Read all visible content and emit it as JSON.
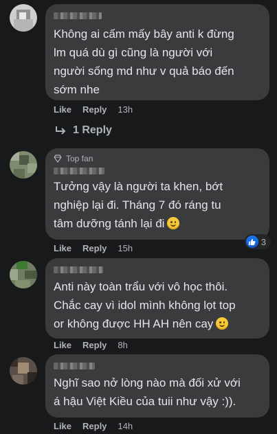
{
  "comments": [
    {
      "text": "Không ai cấm mấy bây anti k đừng\nlm quá dù gì cũng là người với\nngười sống md như v quả báo đến\nsớm nhe",
      "like": "Like",
      "reply": "Reply",
      "time": "13h",
      "replies_label": "1 Reply"
    },
    {
      "badge": "Top fan",
      "text": "Tưởng vậy là người ta khen, bớt\nnghiệp lại đi. Tháng 7 đó ráng tu\ntâm dưỡng tánh lại đi",
      "like": "Like",
      "reply": "Reply",
      "time": "15h",
      "reaction_count": "3"
    },
    {
      "text": "Anti này toàn trẩu với vô học thôi.\nChắc cay vì idol mình không lọt top\nor không được HH AH nên cay",
      "like": "Like",
      "reply": "Reply",
      "time": "8h"
    },
    {
      "text": "Nghĩ sao nở lòng nào mà đối xử với\ná hậu Việt Kiều của tuii như vậy :)).",
      "like": "Like",
      "reply": "Reply",
      "time": "14h"
    }
  ],
  "icons": {
    "reply_arrow": "reply-arrow-icon",
    "like_reaction": "like-reaction-icon",
    "top_fan": "diamond-icon",
    "emoji": "smiling-face-icon"
  },
  "colors": {
    "background": "#18191a",
    "bubble": "#3a3b3c",
    "text": "#e4e6eb",
    "secondary": "#b0b3b8",
    "like_blue": "#1877f2"
  }
}
